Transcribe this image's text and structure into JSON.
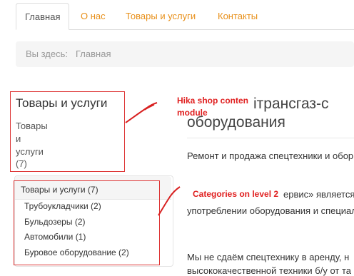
{
  "tabs": [
    {
      "label": "Главная",
      "active": true
    },
    {
      "label": "О нас",
      "active": false
    },
    {
      "label": "Товары и услуги",
      "active": false
    },
    {
      "label": "Контакты",
      "active": false
    }
  ],
  "breadcrumb": {
    "label": "Вы здесь:",
    "current": "Главная"
  },
  "module1": {
    "title": "Товары и услуги",
    "lines": [
      "Товары",
      "и",
      "услуги",
      "(7)"
    ]
  },
  "article": {
    "title_line1": "ітрансгаз-с",
    "title_line2": "оборудования",
    "p1": "Ремонт и продажа спецтехники и обор",
    "p2_line1": "ервис» является",
    "p2_line2": "употреблении оборудования и специал",
    "p3_line1": "Мы не сдаём спецтехнику в аренду, н",
    "p3_line2": "высококачественной техники б/у от та"
  },
  "module2": {
    "title": "Товары и услуги (7)",
    "items": [
      "Трубоукладчики (2)",
      "Бульдозеры (2)",
      "Автомобили (1)",
      "Буровое оборудование (2)"
    ]
  },
  "annotations": {
    "note1_line1": "Hika shop conten",
    "note1_line2": "module",
    "note2": "Categories on level 2",
    "color": "#e02020"
  }
}
